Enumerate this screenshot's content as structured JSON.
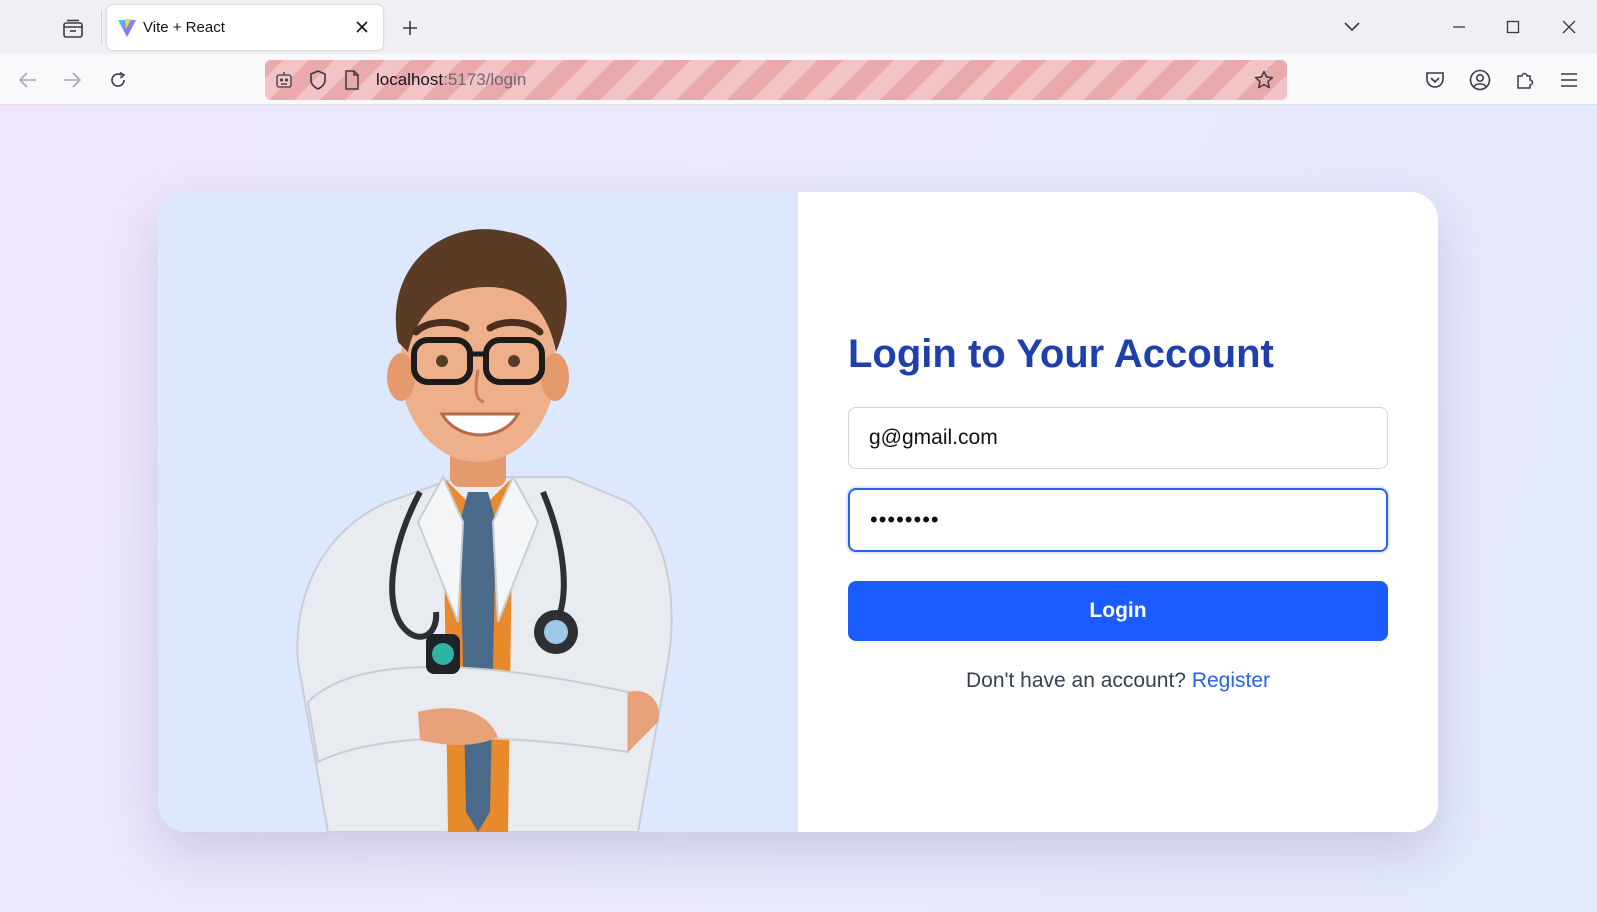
{
  "browser": {
    "tab": {
      "title": "Vite + React"
    },
    "url": {
      "host": "localhost",
      "path": ":5173/login"
    }
  },
  "login": {
    "title": "Login to Your Account",
    "email_value": "g@gmail.com",
    "password_value": "********",
    "button_label": "Login",
    "register_prompt": "Don't have an account?",
    "register_link": "Register"
  },
  "icons": {
    "tab_list": "tab-list-icon",
    "favicon": "vite-logo-icon",
    "close": "close-icon",
    "new_tab": "plus-icon",
    "list_all_tabs": "chevron-down-icon",
    "minimize": "minimize-icon",
    "maximize": "maximize-icon",
    "window_close": "close-icon",
    "back": "arrow-left-icon",
    "forward": "arrow-right-icon",
    "reload": "reload-icon",
    "remote_control": "robot-icon",
    "tracking_protection": "shield-icon",
    "page_info": "page-icon",
    "bookmark": "star-icon",
    "pocket": "pocket-icon",
    "account": "account-icon",
    "extensions": "puzzle-icon",
    "menu": "hamburger-menu-icon"
  },
  "colors": {
    "title": "#1e40af",
    "button": "#1a5cff",
    "link": "#2563eb",
    "illustration_bg": "#dbe8fd"
  }
}
